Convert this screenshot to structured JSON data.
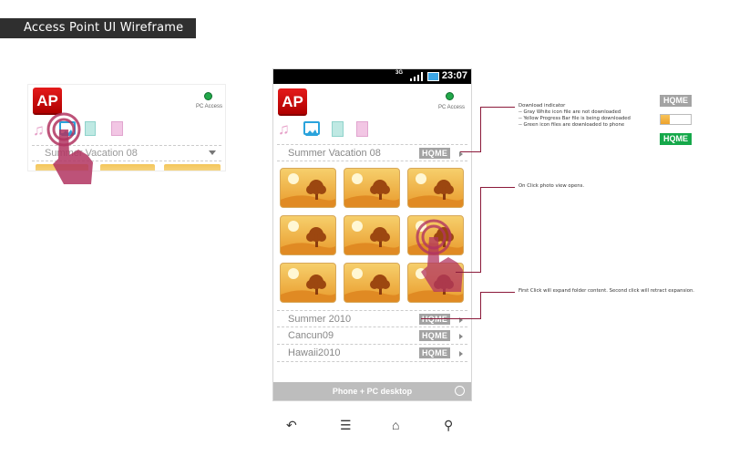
{
  "banner": {
    "title": "Access Point UI Wireframe"
  },
  "app": {
    "logo": "AP",
    "pc_access_label": "PC Access"
  },
  "status_bar": {
    "network": "3G",
    "time": "23:07"
  },
  "tabs": [
    {
      "name": "music-tab",
      "icon": "music-note-icon"
    },
    {
      "name": "photos-tab",
      "icon": "image-icon"
    },
    {
      "name": "video-tab",
      "icon": "film-icon"
    },
    {
      "name": "documents-tab",
      "icon": "document-icon"
    }
  ],
  "mini_preview": {
    "folder_label": "Summer Vacation 08"
  },
  "folders": [
    {
      "label": "Summer Vacation 08",
      "badge": "HQME"
    },
    {
      "label": "Summer 2010",
      "badge": "HQME"
    },
    {
      "label": "Cancun09",
      "badge": "HQME"
    },
    {
      "label": "Hawaii2010",
      "badge": "HQME"
    }
  ],
  "bottom_bar": {
    "label": "Phone + PC desktop"
  },
  "annotations": {
    "download": {
      "title": "Download indicator",
      "line1": "-- Gray White icon file are not downloaded",
      "line2": "-- Yellow Progress Bar file is being downloaded",
      "line3": "-- Green icon files are downloaded to phone"
    },
    "photo": "On Click photo view opens.",
    "folder": "First Click will expand folder content. Second click will retract expansion."
  },
  "legend": {
    "gray_badge": "HQME",
    "progress_fraction": 0.3,
    "green_badge": "HQME"
  },
  "colors": {
    "accent_red": "#d40f0f",
    "green": "#15a84a",
    "gray_badge": "#a3a3a3",
    "annotation_line": "#8b1a3a",
    "thumb_yellow": "#f1b94a"
  }
}
